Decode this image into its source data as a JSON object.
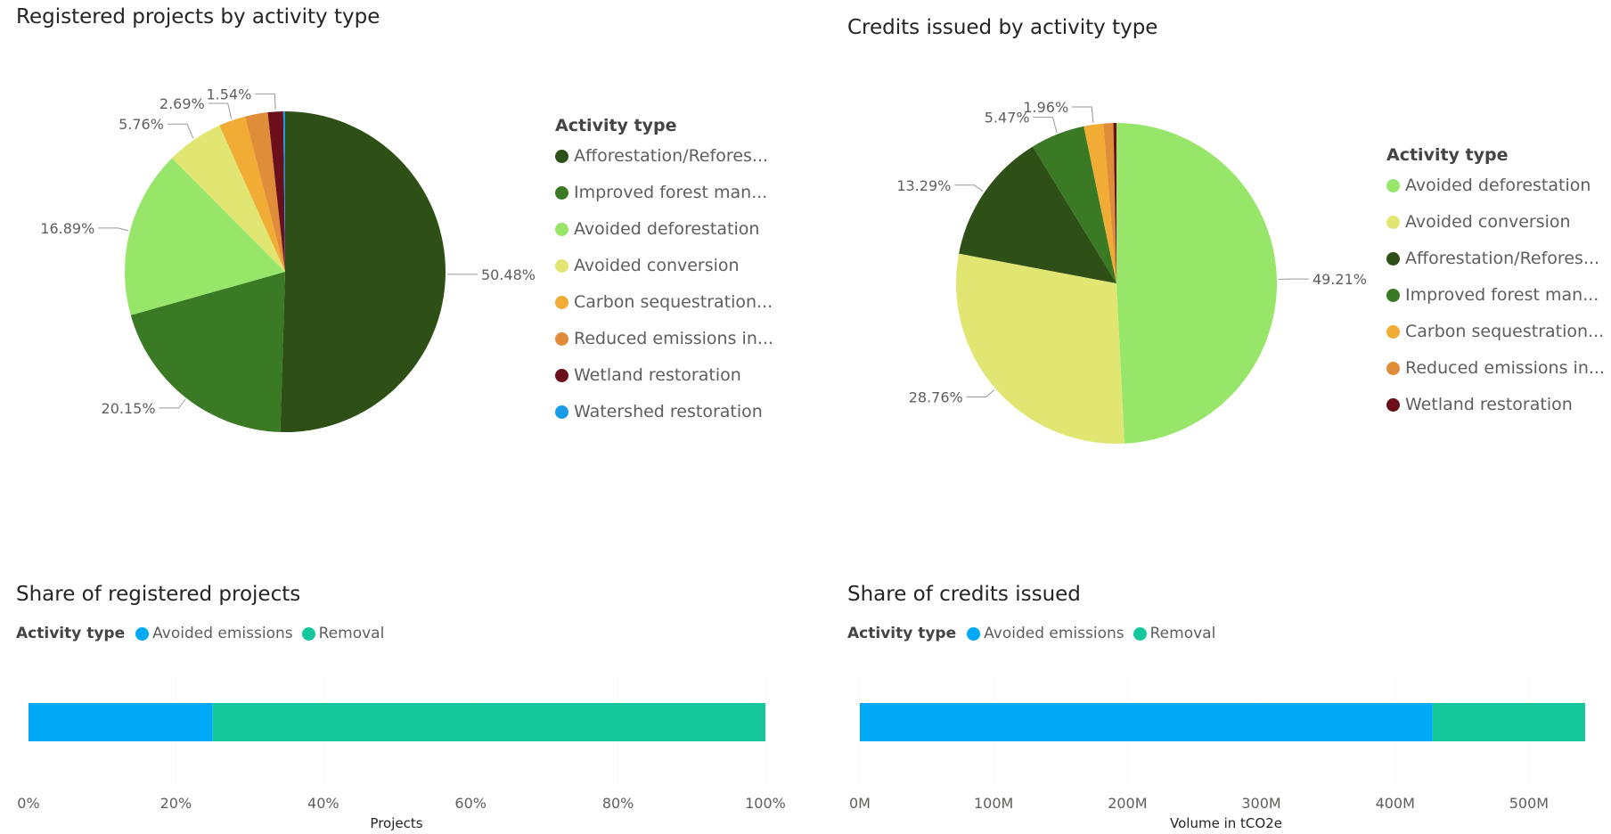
{
  "chart_data": [
    {
      "type": "pie",
      "title": "Registered projects by activity type",
      "legend_title": "Activity type",
      "legend_position": "right",
      "slices": [
        {
          "label": "Afforestation/Refores...",
          "value": 50.48,
          "value_label": "50.48%",
          "color": "#2e4f16"
        },
        {
          "label": "Improved forest man...",
          "value": 20.15,
          "value_label": "20.15%",
          "color": "#3a7a24"
        },
        {
          "label": "Avoided deforestation",
          "value": 16.89,
          "value_label": "16.89%",
          "color": "#97e66a"
        },
        {
          "label": "Avoided conversion",
          "value": 5.76,
          "value_label": "5.76%",
          "color": "#e1e672"
        },
        {
          "label": "Carbon sequestration...",
          "value": 2.69,
          "value_label": "2.69%",
          "color": "#f0ac35"
        },
        {
          "label": "Reduced emissions in...",
          "value": 2.3,
          "value_label": "",
          "color": "#e08d3a"
        },
        {
          "label": "Wetland restoration",
          "value": 1.54,
          "value_label": "1.54%",
          "color": "#6b0f1a"
        },
        {
          "label": "Watershed restoration",
          "value": 0.19,
          "value_label": "",
          "color": "#1a9be8"
        }
      ]
    },
    {
      "type": "pie",
      "title": "Credits issued by activity type",
      "legend_title": "Activity type",
      "legend_position": "right",
      "slices": [
        {
          "label": "Avoided deforestation",
          "value": 49.21,
          "value_label": "49.21%",
          "color": "#97e66a"
        },
        {
          "label": "Avoided conversion",
          "value": 28.76,
          "value_label": "28.76%",
          "color": "#e1e672"
        },
        {
          "label": "Afforestation/Refores...",
          "value": 13.29,
          "value_label": "13.29%",
          "color": "#2e4f16"
        },
        {
          "label": "Improved forest man...",
          "value": 5.47,
          "value_label": "5.47%",
          "color": "#3a7a24"
        },
        {
          "label": "Carbon sequestration...",
          "value": 1.96,
          "value_label": "1.96%",
          "color": "#f0ac35"
        },
        {
          "label": "Reduced emissions in...",
          "value": 1.0,
          "value_label": "",
          "color": "#e08d3a"
        },
        {
          "label": "Wetland restoration",
          "value": 0.31,
          "value_label": "",
          "color": "#6b0f1a"
        }
      ]
    },
    {
      "type": "bar",
      "orientation": "horizontal-stacked",
      "title": "Share of registered projects",
      "legend_title": "Activity type",
      "legend_position": "top-left",
      "xlabel": "Projects",
      "xlim": [
        0,
        100
      ],
      "ticks": [
        "0%",
        "20%",
        "40%",
        "60%",
        "80%",
        "100%"
      ],
      "tick_values": [
        0,
        20,
        40,
        60,
        80,
        100
      ],
      "series": [
        {
          "name": "Avoided emissions",
          "value": 25,
          "color": "#00a8f8"
        },
        {
          "name": "Removal",
          "value": 75,
          "color": "#15c79b"
        }
      ]
    },
    {
      "type": "bar",
      "orientation": "horizontal-stacked",
      "title": "Share of credits issued",
      "legend_title": "Activity type",
      "legend_position": "top-left",
      "xlabel": "Volume in tCO2e",
      "xlim": [
        0,
        542
      ],
      "ticks": [
        "0M",
        "100M",
        "200M",
        "300M",
        "400M",
        "500M"
      ],
      "tick_values": [
        0,
        100,
        200,
        300,
        400,
        500
      ],
      "series": [
        {
          "name": "Avoided emissions",
          "value": 428,
          "color": "#00a8f8"
        },
        {
          "name": "Removal",
          "value": 114,
          "color": "#15c79b"
        }
      ]
    }
  ]
}
